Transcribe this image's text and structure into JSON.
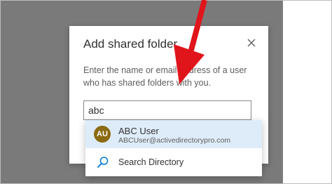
{
  "dialog": {
    "title": "Add shared folder",
    "description": "Enter the name or email address of a user who has shared folders with you.",
    "input_value": "abc",
    "close_icon": "close-icon"
  },
  "suggestions": {
    "user": {
      "initials": "AU",
      "name": "ABC User",
      "email": "ABCUser@activedirectorypro.com",
      "avatar_color": "#8b6a12"
    },
    "directory": {
      "label": "Search Directory",
      "icon": "search-icon"
    }
  },
  "colors": {
    "highlight": "#deecf9",
    "annotation_arrow": "#e0151b",
    "accent": "#0078d4"
  }
}
